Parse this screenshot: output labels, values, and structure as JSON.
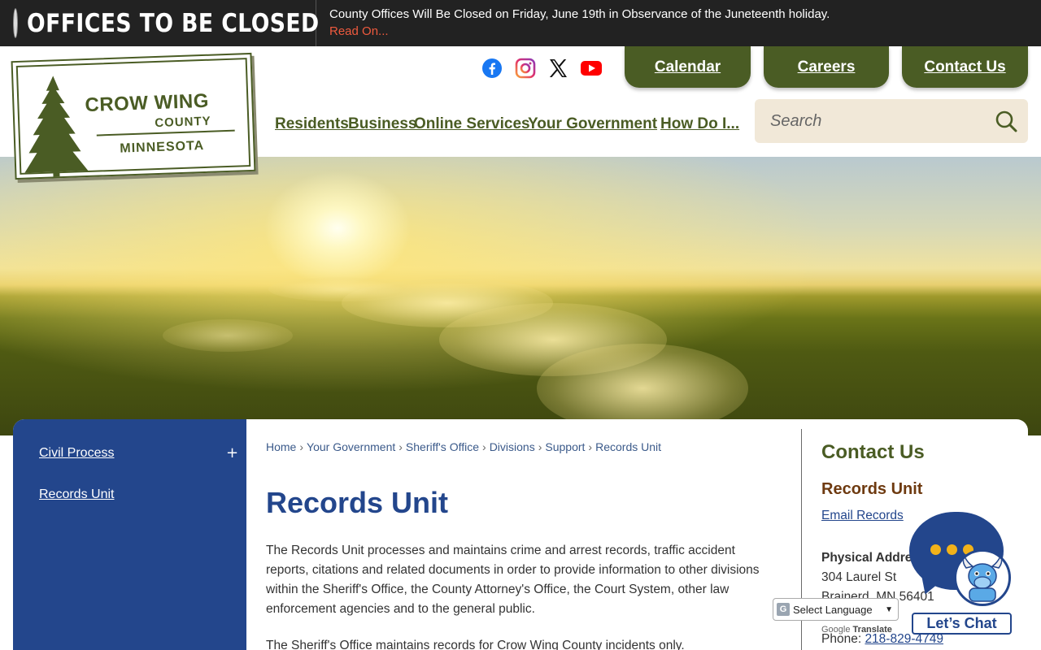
{
  "alert": {
    "title": "OFFICES TO BE CLOSED",
    "message": "County Offices Will Be Closed on Friday, June 19th in Observance of the Juneteenth holiday.",
    "link": "Read On..."
  },
  "logo": {
    "line1": "CROW WING",
    "line2": "COUNTY",
    "line3": "MINNESOTA"
  },
  "social": [
    "facebook-icon",
    "instagram-icon",
    "x-icon",
    "youtube-icon"
  ],
  "top_buttons": {
    "calendar": "Calendar",
    "careers": "Careers",
    "contact": "Contact Us"
  },
  "nav": {
    "residents": "Residents",
    "business": "Business",
    "online_services": "Online Services",
    "your_government": "Your Government",
    "how_do_i": "How Do I..."
  },
  "search": {
    "placeholder": "Search"
  },
  "sidebar": {
    "items": [
      {
        "label": "Civil Process",
        "expand": "+"
      },
      {
        "label": "Records Unit"
      }
    ]
  },
  "breadcrumb": [
    "Home",
    "Your Government",
    "Sheriff's Office",
    "Divisions",
    "Support",
    "Records Unit"
  ],
  "breadcrumb_sep": "›",
  "page": {
    "title": "Records Unit",
    "para1": "The Records Unit processes and maintains crime and arrest records, traffic accident reports, citations and related documents in order to provide information to other divisions within the Sheriff's Office, the County Attorney's Office, the Court System, other law enforcement agencies and to the general public.",
    "para2": "The Sheriff's Office maintains records for Crow Wing County incidents only."
  },
  "contact": {
    "heading": "Contact Us",
    "subheading": "Records Unit",
    "email_link": "Email Records",
    "address_label": "Physical Address",
    "address_line1": "304 Laurel St",
    "address_line2": "Brainerd, MN 56401",
    "phone_label": "Phone: ",
    "phone": "218-829-4749"
  },
  "translate": {
    "select_label": "Select Language",
    "powered_google": "Google",
    "powered_translate": "Translate"
  },
  "chat": {
    "button": "Let’s Chat"
  },
  "colors": {
    "brand_green": "#4a5c24",
    "brand_blue": "#23468c",
    "alert_bg": "#222222",
    "alert_link": "#ef5a3e",
    "search_bg": "#f1e8d8",
    "contact_sub": "#6e3a10"
  }
}
